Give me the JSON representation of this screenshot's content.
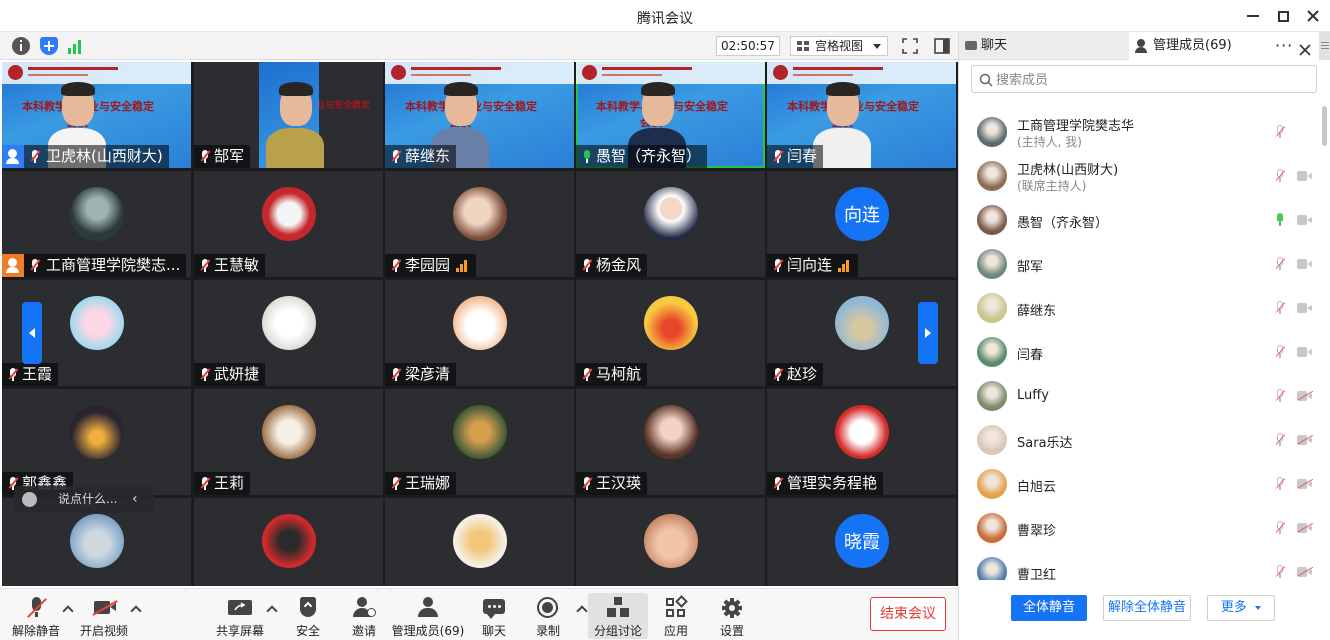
{
  "window": {
    "title": "腾讯会议"
  },
  "toolbar": {
    "timer": "02:50:57",
    "view_mode": "宫格视图"
  },
  "grid": {
    "tiles": [
      {
        "name": "卫虎林(山西财大)"
      },
      {
        "name": "郜军"
      },
      {
        "name": "薛继东"
      },
      {
        "name": "愚智（齐永智）"
      },
      {
        "name": "闫春"
      },
      {
        "name": "工商管理学院樊志..."
      },
      {
        "name": "王慧敏"
      },
      {
        "name": "李园园"
      },
      {
        "name": "杨金风"
      },
      {
        "name": "闫向连",
        "avatar_text": "向连"
      },
      {
        "name": "王霞"
      },
      {
        "name": "武妍捷"
      },
      {
        "name": "梁彦清"
      },
      {
        "name": "马柯航"
      },
      {
        "name": "赵珍"
      },
      {
        "name": "郭鑫鑫"
      },
      {
        "name": "王莉"
      },
      {
        "name": "王瑞娜"
      },
      {
        "name": "王汉瑛"
      },
      {
        "name": "管理实务程艳"
      },
      {
        "name": ""
      },
      {
        "name": ""
      },
      {
        "name": ""
      },
      {
        "name": ""
      },
      {
        "name": "",
        "avatar_text": "晓霞"
      }
    ],
    "slide_text_1": "本科教学与就业与安全稳定",
    "slide_text_2": "会议",
    "chat_placeholder": "说点什么..."
  },
  "bottombar": {
    "unmute": "解除静音",
    "video": "开启视频",
    "share": "共享屏幕",
    "security": "安全",
    "invite": "邀请",
    "members": "管理成员(69)",
    "chat": "聊天",
    "record": "录制",
    "breakout": "分组讨论",
    "apps": "应用",
    "settings": "设置",
    "end": "结束会议"
  },
  "panel": {
    "tab_chat": "聊天",
    "tab_members": "管理成员(69)",
    "search_placeholder": "搜索成员",
    "members": [
      {
        "name": "工商管理学院樊志华",
        "role": "(主持人, 我)",
        "color": "#5a6b6a"
      },
      {
        "name": "卫虎林(山西财大)",
        "role": "(联席主持人)",
        "color": "#8d6b55"
      },
      {
        "name": "愚智（齐永智）",
        "role": "",
        "color": "#7d5b4a"
      },
      {
        "name": "郜军",
        "role": "",
        "color": "#6d8a7a"
      },
      {
        "name": "薛继东",
        "role": "",
        "color": "#c9c58f"
      },
      {
        "name": "闫春",
        "role": "",
        "color": "#5b8a6e"
      },
      {
        "name": "Luffy",
        "role": "",
        "color": "#7a8c6a"
      },
      {
        "name": "Sara乐达",
        "role": "",
        "color": "#d9c7b8"
      },
      {
        "name": "白旭云",
        "role": "",
        "color": "#e6a24a"
      },
      {
        "name": "曹翠珍",
        "role": "",
        "color": "#c86a3a"
      },
      {
        "name": "曹卫红",
        "role": "",
        "color": "#4a7ab0"
      }
    ],
    "mute_all": "全体静音",
    "unmute_all": "解除全体静音",
    "more": "更多"
  },
  "colors": {
    "accent": "#1574f6",
    "danger": "#e23a36",
    "live": "#27c34a"
  }
}
